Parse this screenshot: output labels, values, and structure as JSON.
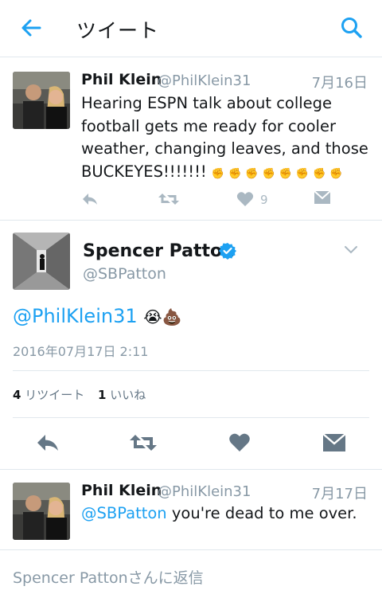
{
  "header": {
    "title": "ツイート",
    "back_icon": "arrow-left-icon",
    "search_icon": "search-icon"
  },
  "tweet1": {
    "name": "Phil Klein",
    "handle": "@PhilKlein31",
    "date": "7月16日",
    "text": "Hearing ESPN talk about college football gets me ready for cooler weather, changing leaves, and those BUCKEYES!!!!!!!",
    "emoji": "✊✊✊✊✊✊✊✊",
    "likes": "9"
  },
  "main": {
    "name": "Spencer Patton",
    "handle": "@SBPatton",
    "mention": "@PhilKlein31",
    "emoji": "😭💩",
    "timestamp": "2016年07月17日 2:11",
    "retweets_count": "4",
    "retweets_label": "リツイート",
    "likes_count": "1",
    "likes_label": "いいね"
  },
  "reply": {
    "name": "Phil Klein",
    "handle": "@PhilKlein31",
    "date": "7月17日",
    "mention": "@SBPatton",
    "text": " you're dead to me over."
  },
  "compose": {
    "placeholder": "Spencer Pattonさんに返信"
  },
  "colors": {
    "accent": "#1da1f2",
    "verified": "#1da1f2",
    "muted": "#8899a6",
    "icon": "#657786",
    "divider": "#e1e8ed"
  }
}
